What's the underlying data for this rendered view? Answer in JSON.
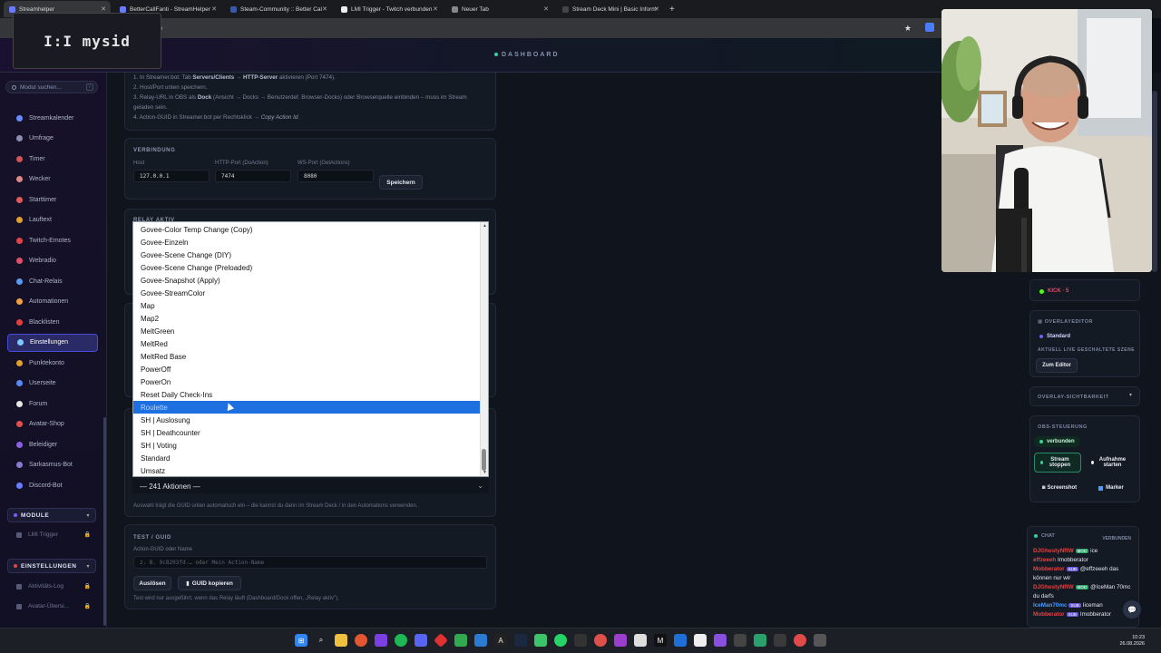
{
  "browser": {
    "tabs": [
      {
        "label": "Streamhelper",
        "active": true
      },
      {
        "label": "BetterCallFanti - StreamHelper",
        "active": false
      },
      {
        "label": "Steam-Community :: Better Cal",
        "active": false
      },
      {
        "label": "LMI Trigger - Twitch verbunden",
        "active": false
      },
      {
        "label": "Neuer Tab",
        "active": false
      },
      {
        "label": "Stream Deck Mini | Basic Inform",
        "active": false
      }
    ],
    "url_fragment": "tup"
  },
  "header": {
    "title": "DASHBOARD",
    "logo_text": "I:I mysid"
  },
  "sidebar": {
    "search_placeholder": "Modul suchen...",
    "search_shortcut": "/",
    "items": [
      {
        "label": "Streamkalender",
        "color": "#6b8cff"
      },
      {
        "label": "Umfrage",
        "color": "#8a8fb0"
      },
      {
        "label": "Timer",
        "color": "#c55"
      },
      {
        "label": "Wecker",
        "color": "#d88"
      },
      {
        "label": "Starttimer",
        "color": "#e05a5a"
      },
      {
        "label": "Lauftext",
        "color": "#e0a030"
      },
      {
        "label": "Twitch-Emotes",
        "color": "#e04545"
      },
      {
        "label": "Webradio",
        "color": "#e0506a"
      },
      {
        "label": "Chat-Relais",
        "color": "#5a9af0"
      },
      {
        "label": "Automationen",
        "color": "#f0a040"
      },
      {
        "label": "Blacklisten",
        "color": "#e04040"
      },
      {
        "label": "Einstellungen",
        "color": "#7cc8ff",
        "active": true
      },
      {
        "label": "Punktekonto",
        "color": "#e0a030"
      },
      {
        "label": "Userseite",
        "color": "#5a8af0"
      },
      {
        "label": "Forum",
        "color": "#e6e6e6"
      },
      {
        "label": "Avatar-Shop",
        "color": "#e05050"
      },
      {
        "label": "Beleidiger",
        "color": "#8a60e0"
      },
      {
        "label": "Sarkasmus-Bot",
        "color": "#8a7ad0"
      },
      {
        "label": "Discord-Bot",
        "color": "#6c7cff"
      }
    ],
    "module_section": "MODULE",
    "module_items": [
      {
        "label": "LMI Trigger"
      }
    ],
    "settings_section": "EINSTELLUNGEN",
    "settings_items": [
      {
        "label": "Aktivitäts-Log"
      },
      {
        "label": "Avatar-Übersi..."
      }
    ]
  },
  "instructions": {
    "step1_a": "1. In Streamer.bot: Tab ",
    "step1_b": "Servers/Clients",
    "step1_c": " → ",
    "step1_d": "HTTP-Server",
    "step1_e": " aktivieren (Port 7474).",
    "step2": "2. Host/Port unten speichern.",
    "step3_a": "3. Relay-URL in OBS als ",
    "step3_b": "Dock",
    "step3_c": " (Ansicht → Docks → Benutzerdef. Browser-Docks) oder Browserquelle einbinden – muss im Stream geladen sein.",
    "step4_a": "4. Action-GUID in Streamer.bot per Rechtsklick → ",
    "step4_b": "Copy Action Id",
    "step4_c": "."
  },
  "connection": {
    "title": "VERBINDUNG",
    "host_label": "Host",
    "host_value": "127.0.0.1",
    "http_label": "HTTP-Port (DoAction)",
    "http_value": "7474",
    "ws_label": "WS-Port (GetActions)",
    "ws_value": "8080",
    "save_button": "Speichern"
  },
  "relay": {
    "title": "RELAY AKTIV"
  },
  "dropdown": {
    "items": [
      "Govee-Color Temp Change (Copy)",
      "Govee-Einzeln",
      "Govee-Scene Change (DIY)",
      "Govee-Scene Change (Preloaded)",
      "Govee-Snapshot (Apply)",
      "Govee-StreamColor",
      "Map",
      "Map2",
      "MeltGreen",
      "MeltRed",
      "MeltRed Base",
      "PowerOff",
      "PowerOn",
      "Reset Daily Check-Ins",
      "Roulette",
      "SH | Auslosung",
      "SH | Deathcounter",
      "SH | Voting",
      "Standard",
      "Umsatz"
    ],
    "selected_index": 14,
    "closed_value": "— 241 Aktionen —",
    "hint": "Auswahl trägt die GUID unten automatisch ein – die kannst du dann im Stream Deck / in den Automations verwenden."
  },
  "test": {
    "title": "TEST / GUID",
    "label": "Action-GUID oder Name",
    "placeholder": "z. B. 9c8203fd-…  oder  Mein Action-Name",
    "trigger_button": "Auslösen",
    "copy_button": "GUID kopieren",
    "hint": "Test wird nur ausgeführt, wenn das Relay läuft (Dashboard/Dock offen, „Relay aktiv\")."
  },
  "right": {
    "kick": "KICK · 5",
    "overlay_editor_title": "OVERLAYEDITOR",
    "overlay_standard": "Standard",
    "live_scene_title": "AKTUELL LIVE GESCHALTETE SZENE",
    "to_editor": "Zum Editor",
    "overlay_visibility": "OVERLAY-SICHTBARKEIT",
    "obs_title": "OBS-STEUERUNG",
    "obs_status": "verbunden",
    "stream_stop": "Stream stoppen",
    "record_start": "Aufnahme starten",
    "screenshot": "Screenshot",
    "marker": "Marker",
    "chat_title": "CHAT",
    "chat_status": "VERBUNDEN"
  },
  "chat": [
    {
      "user": "DJGhostyNRW",
      "badge": "MOD",
      "text": "ice",
      "color": "#e04545"
    },
    {
      "user": "effzeeeh",
      "badge": "",
      "text": "Imobberator",
      "color": "#e04545"
    },
    {
      "user": "Mobberator",
      "badge": "SUB",
      "text": "@effzeeeh das können nur wir",
      "color": "#e04545"
    },
    {
      "user": "DJGhostyNRW",
      "badge": "MOD",
      "text": "@IceMan 70mc du darfs",
      "color": "#e04545"
    },
    {
      "user": "IceMan70mc",
      "badge": "SUB",
      "text": "Iiceman",
      "color": "#4a9cff"
    },
    {
      "user": "Mobberator",
      "badge": "SUB",
      "text": "Imobberator",
      "color": "#e04545"
    }
  ],
  "clock": {
    "time": "10:23",
    "date": "26.08.2026"
  }
}
